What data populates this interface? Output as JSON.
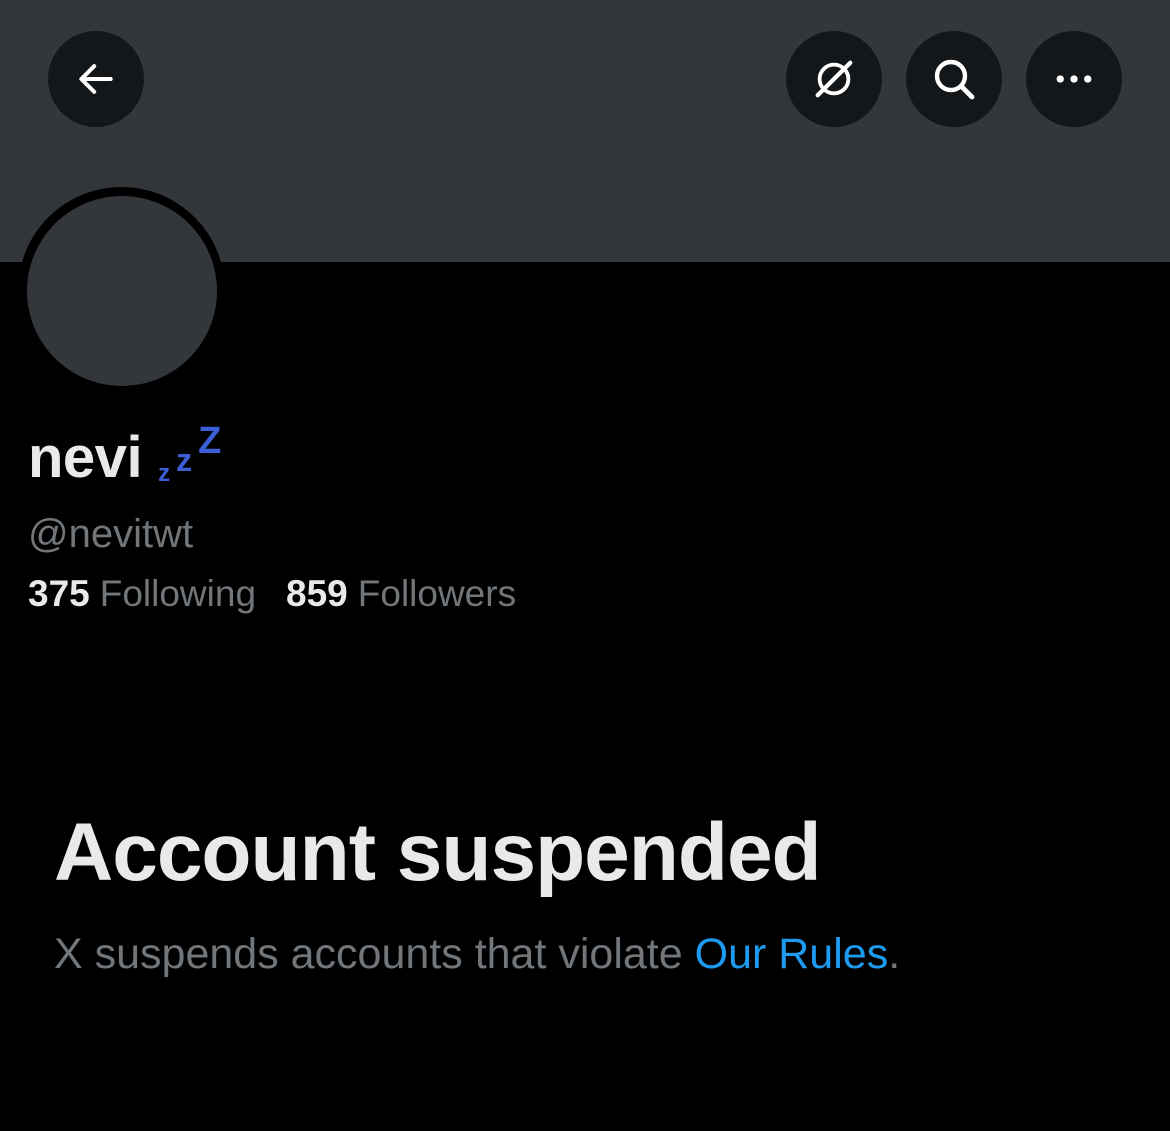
{
  "header": {
    "back_icon": "arrow-left-icon",
    "grok_icon": "grok-icon",
    "search_icon": "search-icon",
    "more_icon": "more-horizontal-icon"
  },
  "profile": {
    "display_name": "nevi",
    "status_emoji": "sleeping-zzz-icon",
    "handle": "@nevitwt",
    "following_count": "375",
    "following_label": "Following",
    "followers_count": "859",
    "followers_label": "Followers"
  },
  "suspension": {
    "title": "Account suspended",
    "message": "X suspends accounts that violate ",
    "rules_link": "Our Rules",
    "period": "."
  },
  "colors": {
    "background": "#000000",
    "banner": "#33363a",
    "primary_text": "#e7e9ea",
    "secondary_text": "#71767b",
    "link": "#1d9bf0",
    "zzz": "#3c5fd8"
  }
}
